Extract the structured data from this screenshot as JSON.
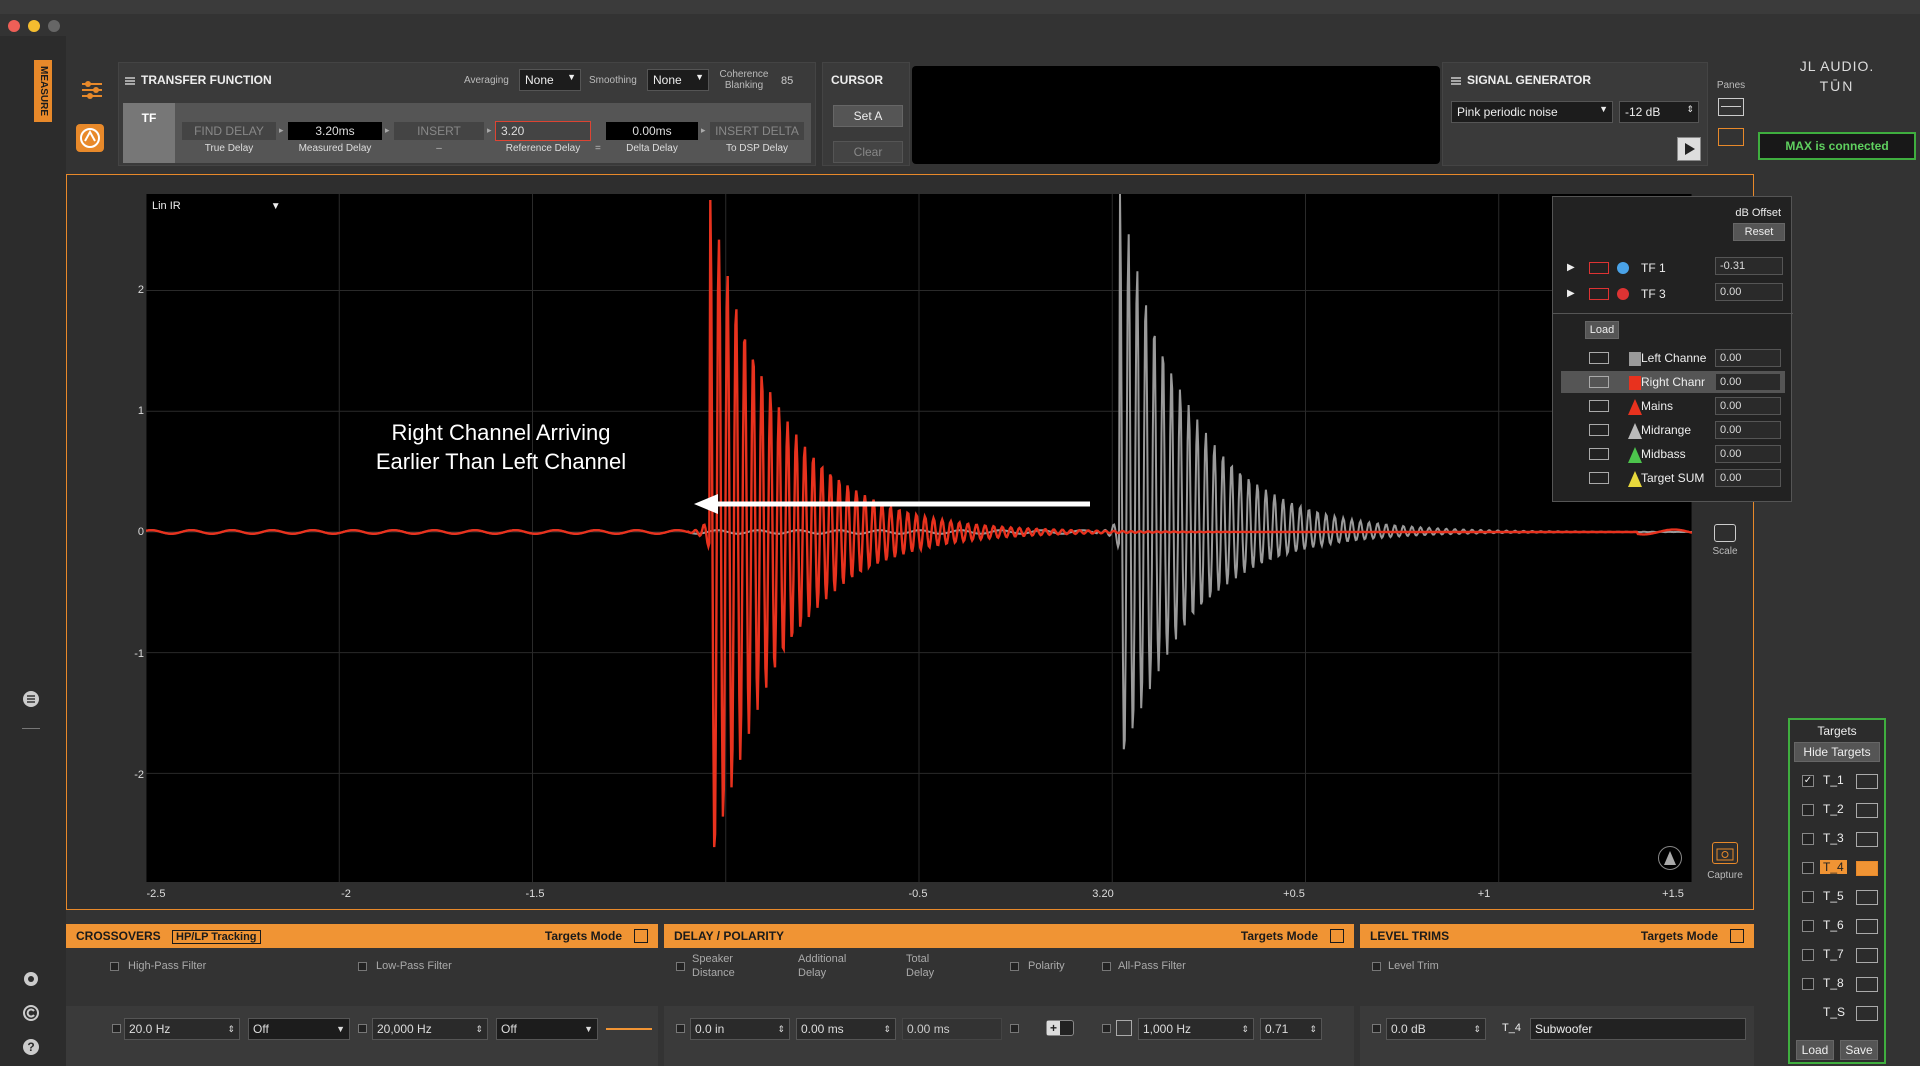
{
  "sidebar_tab": "MEASURE",
  "tf_panel": {
    "title": "TRANSFER FUNCTION",
    "averaging_label": "Averaging",
    "averaging_value": "None",
    "smoothing_label": "Smoothing",
    "smoothing_value": "None",
    "coherence_label": "Coherence\nBlanking",
    "coherence_value": "85",
    "tf_tab": "TF",
    "find_delay": "FIND DELAY",
    "true_delay_label": "True Delay",
    "measured_delay_value": "3.20ms",
    "measured_delay_label": "Measured Delay",
    "insert": "INSERT",
    "insert_sub": "–",
    "reference_delay_value": "3.20",
    "reference_delay_label": "Reference Delay",
    "equals": "=",
    "delta_delay_value": "0.00ms",
    "delta_delay_label": "Delta Delay",
    "insert_delta": "INSERT DELTA",
    "to_dsp_label": "To DSP Delay"
  },
  "cursor_panel": {
    "title": "CURSOR",
    "set_a": "Set A",
    "clear": "Clear"
  },
  "signal_generator": {
    "title": "SIGNAL GENERATOR",
    "signal": "Pink periodic noise",
    "level": "-12 dB"
  },
  "panes_label": "Panes",
  "brand": {
    "line1": "JL AUDIO.",
    "line2": "TŪN"
  },
  "status": "MAX is connected",
  "plot": {
    "mode": "Lin IR",
    "annotation_line1": "Right Channel Arriving",
    "annotation_line2": "Earlier Than Left Channel",
    "scale_label": "Scale",
    "capture_label": "Capture"
  },
  "chart_data": {
    "type": "line",
    "title": "Lin IR",
    "xlim": [
      -2.5,
      1.5
    ],
    "ylim": [
      -2.9,
      2.8
    ],
    "x_ticks": [
      "-2.5",
      "-2",
      "-1.5",
      "-0.5",
      "3.20",
      "+0.5",
      "+1",
      "+1.5"
    ],
    "y_ticks": [
      "2",
      "1",
      "0",
      "-1",
      "-2"
    ],
    "series": [
      {
        "name": "Right Channel",
        "color": "#e8321e",
        "peak_x": -1.04,
        "peak_y": 2.75,
        "trough_y": -2.9
      },
      {
        "name": "Left Channel",
        "color": "#9a9a9a",
        "peak_x": 0.02,
        "peak_y": 2.8,
        "trough_y": -2.0
      }
    ]
  },
  "legend": {
    "offset_title": "dB Offset",
    "reset": "Reset",
    "tf_rows": [
      {
        "name": "TF 1",
        "value": "-0.31",
        "color": "#4aa3e8"
      },
      {
        "name": "TF 3",
        "value": "0.00",
        "color": "#d33"
      }
    ],
    "load": "Load",
    "trace_rows": [
      {
        "name": "Left Channe",
        "value": "0.00",
        "color": "#9a9a9a",
        "shape": "square"
      },
      {
        "name": "Right Chanr",
        "value": "0.00",
        "color": "#e8321e",
        "shape": "square"
      },
      {
        "name": "Mains",
        "value": "0.00",
        "color": "#e8321e",
        "shape": "triangle"
      },
      {
        "name": "Midrange",
        "value": "0.00",
        "color": "#bbbbbb",
        "shape": "triangle"
      },
      {
        "name": "Midbass",
        "value": "0.00",
        "color": "#4cc44c",
        "shape": "triangle"
      },
      {
        "name": "Target SUM",
        "value": "0.00",
        "color": "#e8d83c",
        "shape": "triangle"
      }
    ]
  },
  "targets": {
    "title": "Targets",
    "hide": "Hide Targets",
    "items": [
      "T_1",
      "T_2",
      "T_3",
      "T_4",
      "T_5",
      "T_6",
      "T_7",
      "T_8",
      "T_S"
    ],
    "load": "Load",
    "save": "Save"
  },
  "crossovers": {
    "title": "CROSSOVERS",
    "tracking": "HP/LP Tracking",
    "mode": "Targets Mode",
    "hp_label": "High-Pass Filter",
    "lp_label": "Low-Pass Filter",
    "hp_freq": "20.0 Hz",
    "hp_type": "Off",
    "lp_freq": "20,000 Hz",
    "lp_type": "Off"
  },
  "delay": {
    "title": "DELAY / POLARITY",
    "mode": "Targets Mode",
    "speaker_label": "Speaker\nDistance",
    "additional_label": "Additional\nDelay",
    "total_label": "Total\nDelay",
    "polarity_label": "Polarity",
    "allpass_label": "All-Pass Filter",
    "distance": "0.0 in",
    "additional": "0.00 ms",
    "total": "0.00 ms",
    "ap_freq": "1,000 Hz",
    "ap_q": "0.71"
  },
  "level": {
    "title": "LEVEL TRIMS",
    "mode": "Targets Mode",
    "trim_label": "Level Trim",
    "trim_value": "0.0 dB",
    "target": "T_4",
    "name": "Subwoofer"
  }
}
